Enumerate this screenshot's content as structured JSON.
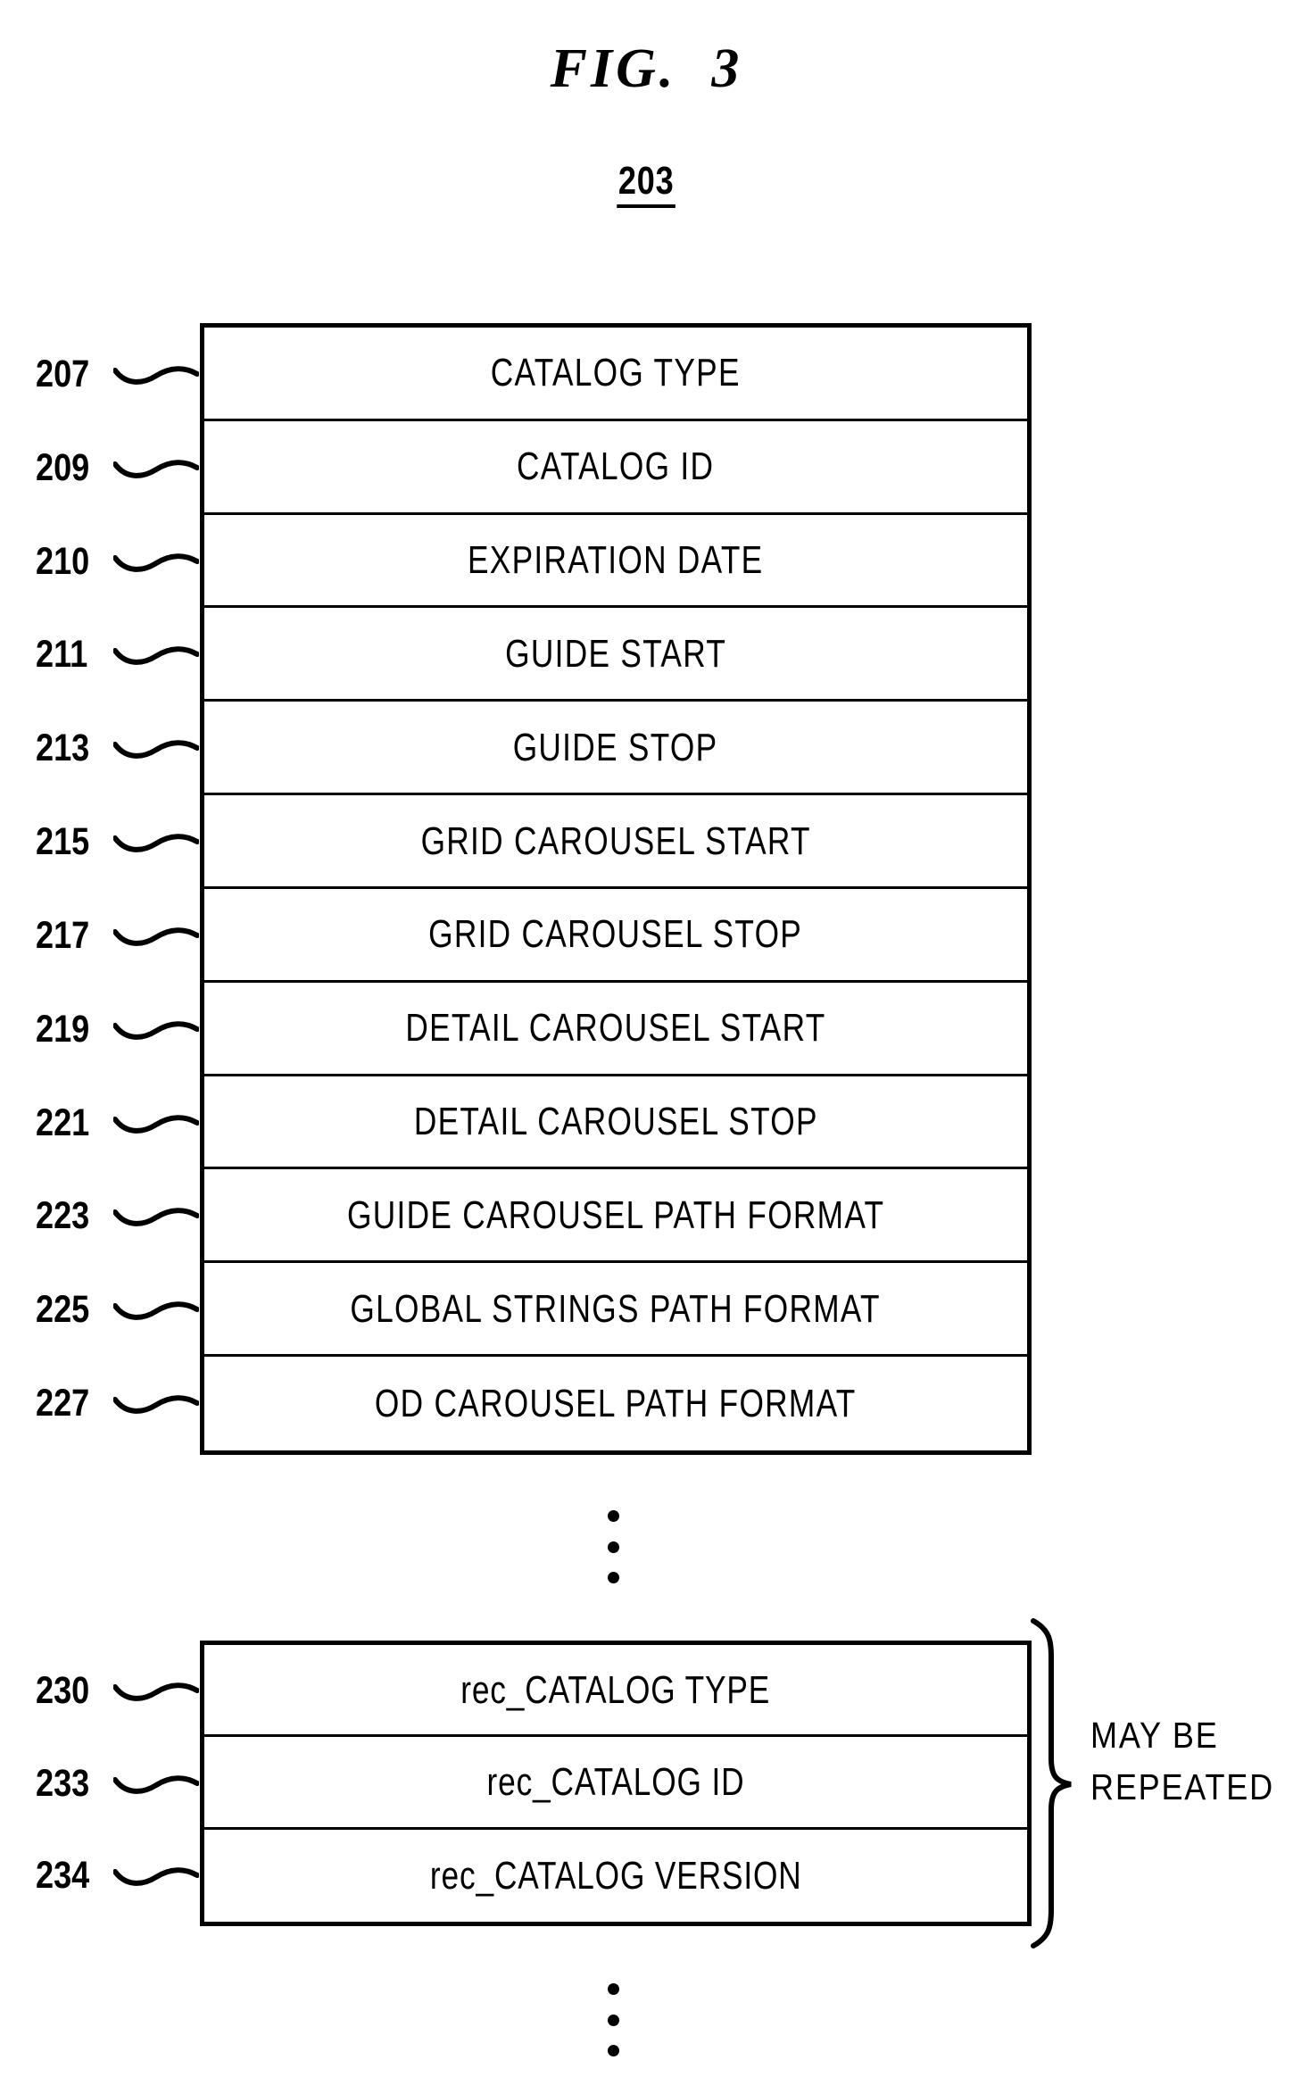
{
  "figure": {
    "title": "FIG.  3",
    "reference_number": "203"
  },
  "catalog_table": {
    "rows": [
      {
        "ref": "207",
        "label": "CATALOG TYPE"
      },
      {
        "ref": "209",
        "label": "CATALOG ID"
      },
      {
        "ref": "210",
        "label": "EXPIRATION DATE"
      },
      {
        "ref": "211",
        "label": "GUIDE START"
      },
      {
        "ref": "213",
        "label": "GUIDE STOP"
      },
      {
        "ref": "215",
        "label": "GRID CAROUSEL START"
      },
      {
        "ref": "217",
        "label": "GRID CAROUSEL STOP"
      },
      {
        "ref": "219",
        "label": "DETAIL CAROUSEL START"
      },
      {
        "ref": "221",
        "label": "DETAIL CAROUSEL STOP"
      },
      {
        "ref": "223",
        "label": "GUIDE CAROUSEL PATH FORMAT"
      },
      {
        "ref": "225",
        "label": "GLOBAL STRINGS PATH FORMAT"
      },
      {
        "ref": "227",
        "label": "OD CAROUSEL PATH FORMAT"
      }
    ]
  },
  "record_table": {
    "rows": [
      {
        "ref": "230",
        "label": "rec_CATALOG TYPE"
      },
      {
        "ref": "233",
        "label": "rec_CATALOG ID"
      },
      {
        "ref": "234",
        "label": "rec_CATALOG VERSION"
      }
    ],
    "annotation": {
      "line1": "MAY BE",
      "line2": "REPEATED"
    }
  },
  "ellipses": {
    "middle": "vertical-ellipsis",
    "bottom": "vertical-ellipsis"
  },
  "colors": {
    "ink": "#000000",
    "paper": "#ffffff"
  }
}
